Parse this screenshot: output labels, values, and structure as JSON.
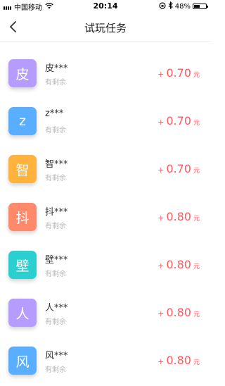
{
  "status_bar": {
    "carrier": "中国移动",
    "time": "20:14",
    "battery": "48%",
    "battery_level": 0.48
  },
  "nav": {
    "title": "试玩任务"
  },
  "tasks": [
    {
      "icon_char": "皮",
      "icon_color": "#b59cff",
      "name": "皮***",
      "status": "有剩余",
      "prefix": "+",
      "amount": "0.70",
      "unit": "元"
    },
    {
      "icon_char": "z",
      "icon_color": "#5aaeff",
      "name": "z***",
      "status": "有剩余",
      "prefix": "+",
      "amount": "0.70",
      "unit": "元"
    },
    {
      "icon_char": "智",
      "icon_color": "#ffb33f",
      "name": "智***",
      "status": "有剩余",
      "prefix": "+",
      "amount": "0.70",
      "unit": "元"
    },
    {
      "icon_char": "抖",
      "icon_color": "#ff8a6b",
      "name": "抖***",
      "status": "有剩余",
      "prefix": "+",
      "amount": "0.80",
      "unit": "元"
    },
    {
      "icon_char": "壁",
      "icon_color": "#2bcfcf",
      "name": "壁***",
      "status": "有剩余",
      "prefix": "+",
      "amount": "0.80",
      "unit": "元"
    },
    {
      "icon_char": "人",
      "icon_color": "#b59cff",
      "name": "人***",
      "status": "有剩余",
      "prefix": "+",
      "amount": "0.80",
      "unit": "元"
    },
    {
      "icon_char": "风",
      "icon_color": "#5aaeff",
      "name": "风***",
      "status": "有剩余",
      "prefix": "+",
      "amount": "0.80",
      "unit": "元"
    }
  ]
}
